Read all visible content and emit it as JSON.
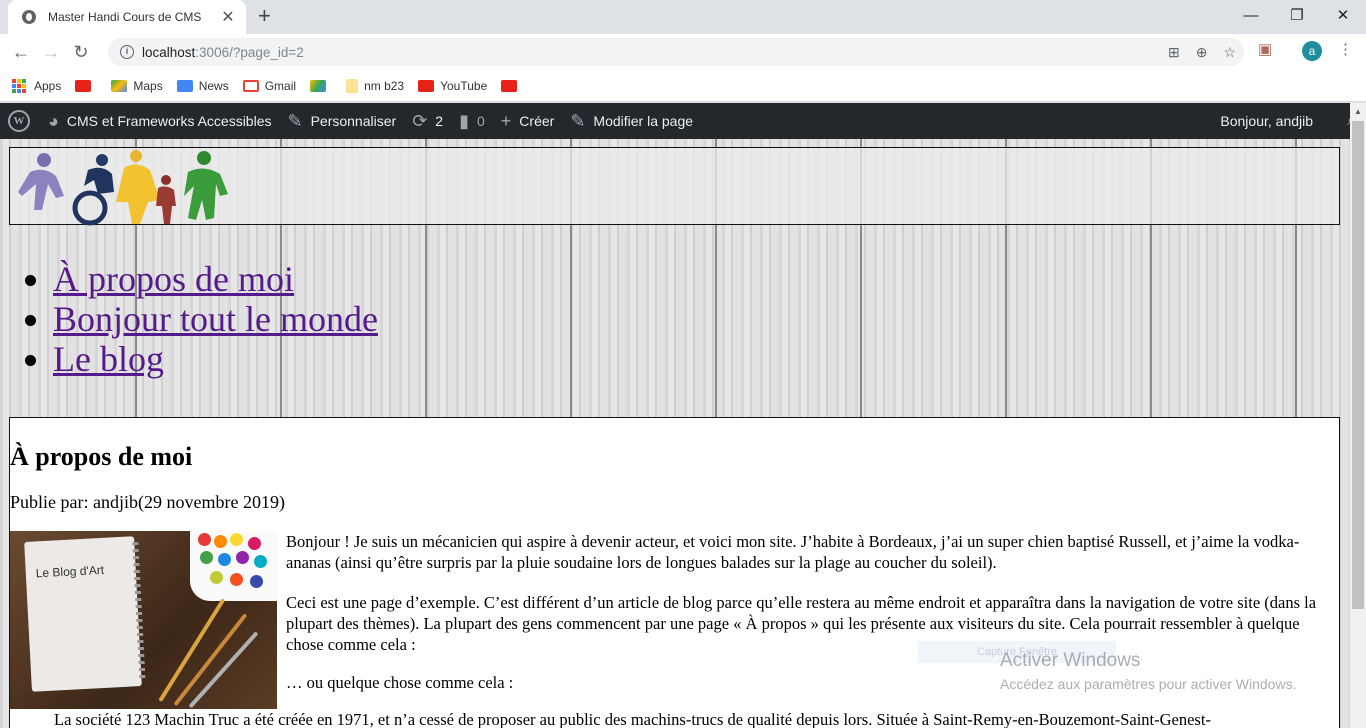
{
  "browser": {
    "tab_title": "Master Handi Cours de CMS",
    "url_host": "localhost",
    "url_path": ":3006/?page_id=2",
    "avatar_letter": "a",
    "bookmarks": [
      {
        "label": "Apps",
        "icon": "apps-grid-icon"
      },
      {
        "label": "",
        "icon": "youtube-icon"
      },
      {
        "label": "Maps",
        "icon": "maps-icon"
      },
      {
        "label": "News",
        "icon": "news-icon"
      },
      {
        "label": "Gmail",
        "icon": "gmail-icon"
      },
      {
        "label": "",
        "icon": "drive-icon"
      },
      {
        "label": "nm b23",
        "icon": "folder-icon"
      },
      {
        "label": "YouTube",
        "icon": "youtube-icon"
      },
      {
        "label": "",
        "icon": "youtube-icon"
      }
    ]
  },
  "adminbar": {
    "site_name": "CMS et Frameworks Accessibles",
    "customize": "Personnaliser",
    "updates_count": "2",
    "comments_count": "0",
    "create": "Créer",
    "edit_page": "Modifier la page",
    "greeting": "Bonjour, andjib"
  },
  "menu": [
    "À propos de moi",
    "Bonjour tout le monde",
    "Le blog"
  ],
  "post": {
    "title": "À propos de moi",
    "meta": "Publie par: andjib(29 novembre 2019)",
    "image_caption": "Le Blog d'Art",
    "p1": "Bonjour ! Je suis un mécanicien qui aspire à devenir acteur, et voici mon site. J’habite à Bordeaux, j’ai un super chien baptisé Russell, et j’aime la vodka-ananas (ainsi qu’être surpris par la pluie soudaine lors de longues balades sur la plage au coucher du soleil).",
    "p2": "Ceci est une page d’exemple. C’est différent d’un article de blog parce qu’elle restera au même endroit et apparaîtra dans la navigation de votre site (dans la plupart des thèmes). La plupart des gens commencent par une page « À propos » qui les présente aux visiteurs du site. Cela pourrait ressembler à quelque chose comme cela :",
    "p3": "… ou quelque chose comme cela :",
    "quote": "La société 123 Machin Truc a été créée en 1971, et n’a cessé de proposer au public des machins-trucs de qualité depuis lors. Située à Saint-Remy-en-Bouzemont-Saint-Genest-"
  },
  "overlay": {
    "capture": "Capture Fenêtre",
    "activate_title": "Activer Windows",
    "activate_sub": "Accédez aux paramètres pour activer Windows."
  }
}
